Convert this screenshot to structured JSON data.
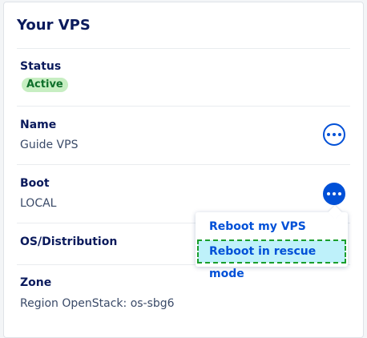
{
  "card": {
    "title": "Your VPS"
  },
  "status": {
    "label": "Status",
    "badge": "Active"
  },
  "name": {
    "label": "Name",
    "value": "Guide VPS",
    "action_icon": "more-horizontal-icon"
  },
  "boot": {
    "label": "Boot",
    "value": "LOCAL",
    "action_icon": "more-horizontal-icon"
  },
  "os": {
    "label": "OS/Distribution"
  },
  "zone": {
    "label": "Zone",
    "value": "Region OpenStack: os-sbg6"
  },
  "boot_menu": {
    "items": [
      {
        "label": "Reboot my VPS"
      },
      {
        "label": "Reboot in rescue mode",
        "highlighted": true
      }
    ]
  },
  "colors": {
    "primary": "#0050d7",
    "title": "#0a1a5c",
    "badge_bg": "#c7eec2",
    "badge_text": "#0e6f2a",
    "highlight_bg": "#bef1fa",
    "highlight_outline": "#1a9e2c"
  }
}
